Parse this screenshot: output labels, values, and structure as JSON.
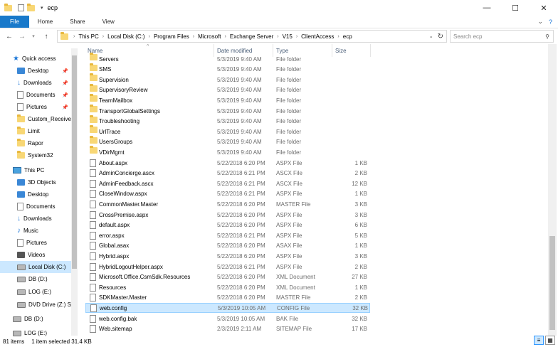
{
  "window": {
    "title": "ecp"
  },
  "ribbon": {
    "tabs": [
      "File",
      "Home",
      "Share",
      "View"
    ],
    "help_icon": "?"
  },
  "address": {
    "crumbs": [
      "This PC",
      "Local Disk (C:)",
      "Program Files",
      "Microsoft",
      "Exchange Server",
      "V15",
      "ClientAccess",
      "ecp"
    ]
  },
  "search": {
    "placeholder": "Search ecp"
  },
  "nav": {
    "items": [
      {
        "label": "Quick access",
        "icon": "star-icon"
      },
      {
        "label": "Desktop",
        "icon": "desktop-icon",
        "pinned": true
      },
      {
        "label": "Downloads",
        "icon": "download-icon",
        "pinned": true
      },
      {
        "label": "Documents",
        "icon": "documents-icon",
        "pinned": true
      },
      {
        "label": "Pictures",
        "icon": "pictures-icon",
        "pinned": true
      },
      {
        "label": "Custom_Receive",
        "icon": "folder-icon"
      },
      {
        "label": "Limit",
        "icon": "folder-icon"
      },
      {
        "label": "Rapor",
        "icon": "folder-icon"
      },
      {
        "label": "System32",
        "icon": "folder-icon"
      },
      {
        "label": "This PC",
        "icon": "this-pc-icon"
      },
      {
        "label": "3D Objects",
        "icon": "3d-objects-icon"
      },
      {
        "label": "Desktop",
        "icon": "desktop-icon"
      },
      {
        "label": "Documents",
        "icon": "documents-icon"
      },
      {
        "label": "Downloads",
        "icon": "download-icon"
      },
      {
        "label": "Music",
        "icon": "music-icon"
      },
      {
        "label": "Pictures",
        "icon": "pictures-icon"
      },
      {
        "label": "Videos",
        "icon": "videos-icon"
      },
      {
        "label": "Local Disk (C:)",
        "icon": "drive-icon",
        "selected": true
      },
      {
        "label": "DB (D:)",
        "icon": "drive-icon"
      },
      {
        "label": "LOG (E:)",
        "icon": "drive-icon"
      },
      {
        "label": "DVD Drive (Z:) SS",
        "icon": "dvd-drive-icon"
      },
      {
        "label": "DB (D:)",
        "icon": "drive-icon"
      },
      {
        "label": "LOG (E:)",
        "icon": "drive-icon"
      }
    ]
  },
  "columns": {
    "name": "Name",
    "date": "Date modified",
    "type": "Type",
    "size": "Size"
  },
  "files": [
    {
      "name": "Servers",
      "date": "5/3/2019 9:40 AM",
      "type": "File folder",
      "size": "",
      "folder": true
    },
    {
      "name": "SMS",
      "date": "5/3/2019 9:40 AM",
      "type": "File folder",
      "size": "",
      "folder": true
    },
    {
      "name": "Supervision",
      "date": "5/3/2019 9:40 AM",
      "type": "File folder",
      "size": "",
      "folder": true
    },
    {
      "name": "SupervisoryReview",
      "date": "5/3/2019 9:40 AM",
      "type": "File folder",
      "size": "",
      "folder": true
    },
    {
      "name": "TeamMailbox",
      "date": "5/3/2019 9:40 AM",
      "type": "File folder",
      "size": "",
      "folder": true
    },
    {
      "name": "TransportGlobalSettings",
      "date": "5/3/2019 9:40 AM",
      "type": "File folder",
      "size": "",
      "folder": true
    },
    {
      "name": "Troubleshooting",
      "date": "5/3/2019 9:40 AM",
      "type": "File folder",
      "size": "",
      "folder": true
    },
    {
      "name": "UrlTrace",
      "date": "5/3/2019 9:40 AM",
      "type": "File folder",
      "size": "",
      "folder": true
    },
    {
      "name": "UsersGroups",
      "date": "5/3/2019 9:40 AM",
      "type": "File folder",
      "size": "",
      "folder": true
    },
    {
      "name": "VDirMgmt",
      "date": "5/3/2019 9:40 AM",
      "type": "File folder",
      "size": "",
      "folder": true
    },
    {
      "name": "About.aspx",
      "date": "5/22/2018 6:20 PM",
      "type": "ASPX File",
      "size": "1 KB"
    },
    {
      "name": "AdminConcierge.ascx",
      "date": "5/22/2018 6:21 PM",
      "type": "ASCX File",
      "size": "2 KB"
    },
    {
      "name": "AdminFeedback.ascx",
      "date": "5/22/2018 6:21 PM",
      "type": "ASCX File",
      "size": "12 KB"
    },
    {
      "name": "CloseWindow.aspx",
      "date": "5/22/2018 6:21 PM",
      "type": "ASPX File",
      "size": "1 KB"
    },
    {
      "name": "CommonMaster.Master",
      "date": "5/22/2018 6:20 PM",
      "type": "MASTER File",
      "size": "3 KB"
    },
    {
      "name": "CrossPremise.aspx",
      "date": "5/22/2018 6:20 PM",
      "type": "ASPX File",
      "size": "3 KB"
    },
    {
      "name": "default.aspx",
      "date": "5/22/2018 6:20 PM",
      "type": "ASPX File",
      "size": "6 KB"
    },
    {
      "name": "error.aspx",
      "date": "5/22/2018 6:21 PM",
      "type": "ASPX File",
      "size": "5 KB"
    },
    {
      "name": "Global.asax",
      "date": "5/22/2018 6:20 PM",
      "type": "ASAX File",
      "size": "1 KB"
    },
    {
      "name": "Hybrid.aspx",
      "date": "5/22/2018 6:20 PM",
      "type": "ASPX File",
      "size": "3 KB"
    },
    {
      "name": "HybridLogoutHelper.aspx",
      "date": "5/22/2018 6:21 PM",
      "type": "ASPX File",
      "size": "2 KB"
    },
    {
      "name": "Microsoft.Office.CsmSdk.Resources",
      "date": "5/22/2018 6:20 PM",
      "type": "XML Document",
      "size": "27 KB"
    },
    {
      "name": "Resources",
      "date": "5/22/2018 6:20 PM",
      "type": "XML Document",
      "size": "1 KB"
    },
    {
      "name": "SDKMaster.Master",
      "date": "5/22/2018 6:20 PM",
      "type": "MASTER File",
      "size": "2 KB"
    },
    {
      "name": "web.config",
      "date": "5/3/2019 10:05 AM",
      "type": "CONFIG File",
      "size": "32 KB",
      "selected": true
    },
    {
      "name": "web.config.bak",
      "date": "5/3/2019 10:05 AM",
      "type": "BAK File",
      "size": "32 KB"
    },
    {
      "name": "Web.sitemap",
      "date": "2/3/2019 2:11 AM",
      "type": "SITEMAP File",
      "size": "17 KB"
    }
  ],
  "status": {
    "count": "81 items",
    "selection": "1 item selected  31.4 KB"
  }
}
